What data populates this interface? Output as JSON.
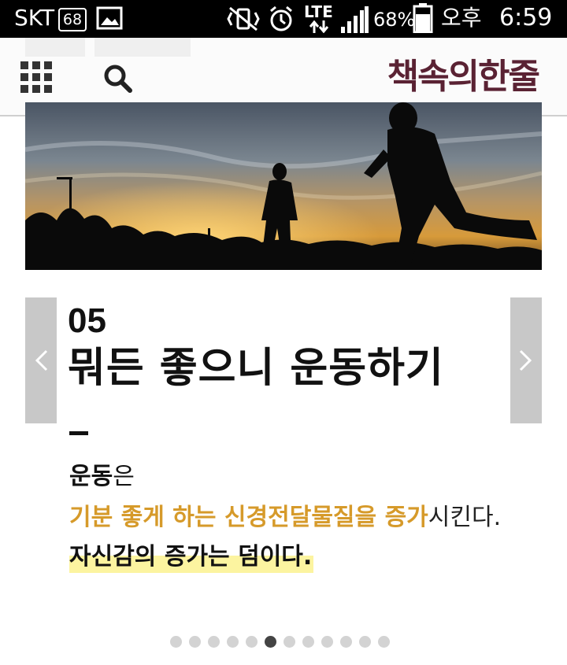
{
  "status_bar": {
    "carrier": "SKT",
    "notification_count": "68",
    "network_type": "LTE",
    "battery_percent": "68%",
    "time_period": "오후",
    "time": "6:59"
  },
  "header": {
    "logo_text": "책속의한줄"
  },
  "slide": {
    "number": "05",
    "title": "뭐든 좋으니 운동하기",
    "subject_bold": "운동",
    "subject_rest": "은",
    "line1_highlight": "기분 좋게 하는 신경전달물질을 증가",
    "line1_rest": "시킨다.",
    "line2": "자신감의 증가는 덤이다."
  },
  "pagination": {
    "total": 12,
    "current": 6
  },
  "colors": {
    "logo": "#5a2233",
    "accent_orange": "#d69a2a",
    "highlight_yellow": "#fcf4a0",
    "nav_button": "#c8c8c8"
  }
}
